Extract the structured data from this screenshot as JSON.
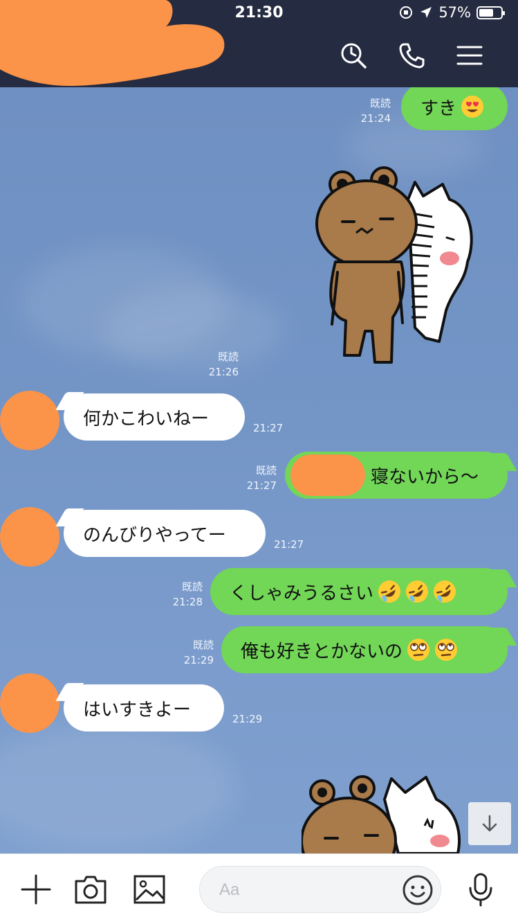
{
  "status": {
    "time": "21:30",
    "battery": "57%"
  },
  "header": {
    "icons": [
      "search-icon",
      "phone-icon",
      "menu-icon"
    ],
    "title_redacted": true
  },
  "colors": {
    "header_bg": "#252b40",
    "chat_bg": "#7394c4",
    "out_bubble": "#72d657",
    "in_bubble": "#ffffff",
    "redaction": "#fb9349"
  },
  "messages": [
    {
      "dir": "out",
      "text": "すき",
      "emoji": [
        "heart-eyes-emoji"
      ],
      "read": "既読",
      "time": "21:24"
    },
    {
      "dir": "out",
      "type": "sticker",
      "sticker": "bear-and-rabbit-sticker",
      "read": "既読",
      "time": "21:26"
    },
    {
      "dir": "in",
      "text": "何かこわいねー",
      "time": "21:27"
    },
    {
      "dir": "out",
      "text": "寝ないから〜",
      "prefix_redacted": true,
      "read": "既読",
      "time": "21:27"
    },
    {
      "dir": "in",
      "text": "のんびりやってー",
      "time": "21:27"
    },
    {
      "dir": "out",
      "text": "くしゃみうるさい",
      "emoji": [
        "rofl-emoji",
        "rofl-emoji",
        "rofl-emoji"
      ],
      "read": "既読",
      "time": "21:28"
    },
    {
      "dir": "out",
      "text": "俺も好きとかないの",
      "emoji": [
        "eye-roll-emoji",
        "eye-roll-emoji"
      ],
      "read": "既読",
      "time": "21:29"
    },
    {
      "dir": "in",
      "text": "はいすきよー",
      "time": "21:29"
    },
    {
      "dir": "in",
      "type": "sticker",
      "sticker": "bear-and-rabbit-sticker-partial"
    }
  ],
  "input": {
    "placeholder": "Aa",
    "buttons": [
      "plus-icon",
      "camera-icon",
      "image-icon",
      "smiley-icon",
      "microphone-icon"
    ]
  }
}
